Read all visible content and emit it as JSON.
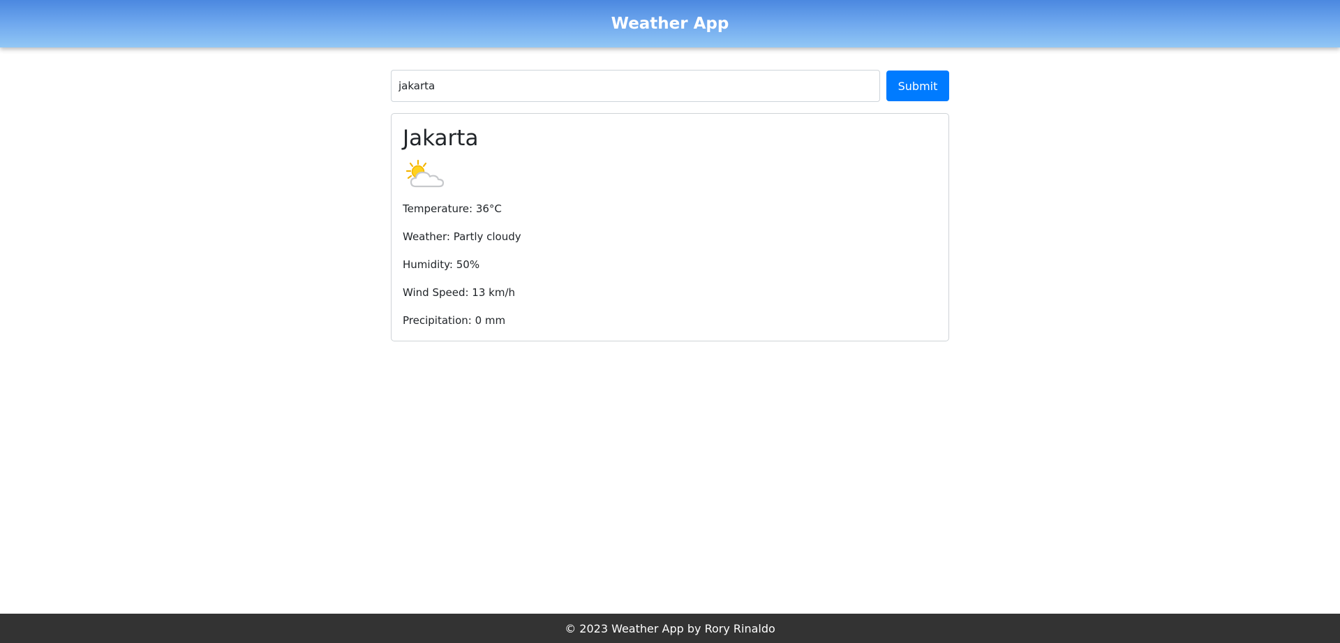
{
  "header": {
    "title": "Weather App"
  },
  "search": {
    "value": "jakarta",
    "submit_label": "Submit"
  },
  "weather": {
    "city": "Jakarta",
    "icon": "partly-cloudy-icon",
    "lines": [
      "Temperature: 36°C",
      "Weather: Partly cloudy",
      "Humidity: 50%",
      "Wind Speed: 13 km/h",
      "Precipitation: 0 mm"
    ]
  },
  "footer": {
    "text": "© 2023 Weather App by Rory Rinaldo"
  },
  "colors": {
    "accent": "#007bff",
    "header_top": "#4b88e0",
    "header_bottom": "#92c7f5",
    "footer_bg": "#333333"
  }
}
